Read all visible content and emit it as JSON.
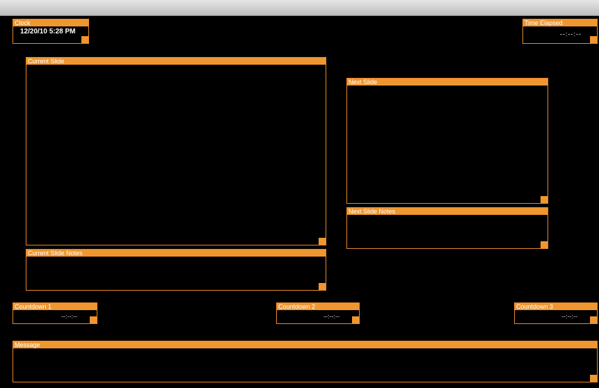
{
  "clock": {
    "title": "Clock",
    "value": "12/20/10 5:28 PM"
  },
  "time_elapsed": {
    "title": "Time Elapsed",
    "value": "--:--:--"
  },
  "current_slide": {
    "title": "Current Slide"
  },
  "current_slide_notes": {
    "title": "Current Slide Notes"
  },
  "next_slide": {
    "title": "Next Slide"
  },
  "next_slide_notes": {
    "title": "Next Slide Notes"
  },
  "countdowns": [
    {
      "title": "Countdown 1",
      "value": "--:--:--"
    },
    {
      "title": "Countdown 2",
      "value": "--:--:--"
    },
    {
      "title": "Countdown 3",
      "value": "--:--:--"
    }
  ],
  "message": {
    "title": "Message"
  },
  "colors": {
    "accent": "#f0962f",
    "background": "#000000"
  }
}
